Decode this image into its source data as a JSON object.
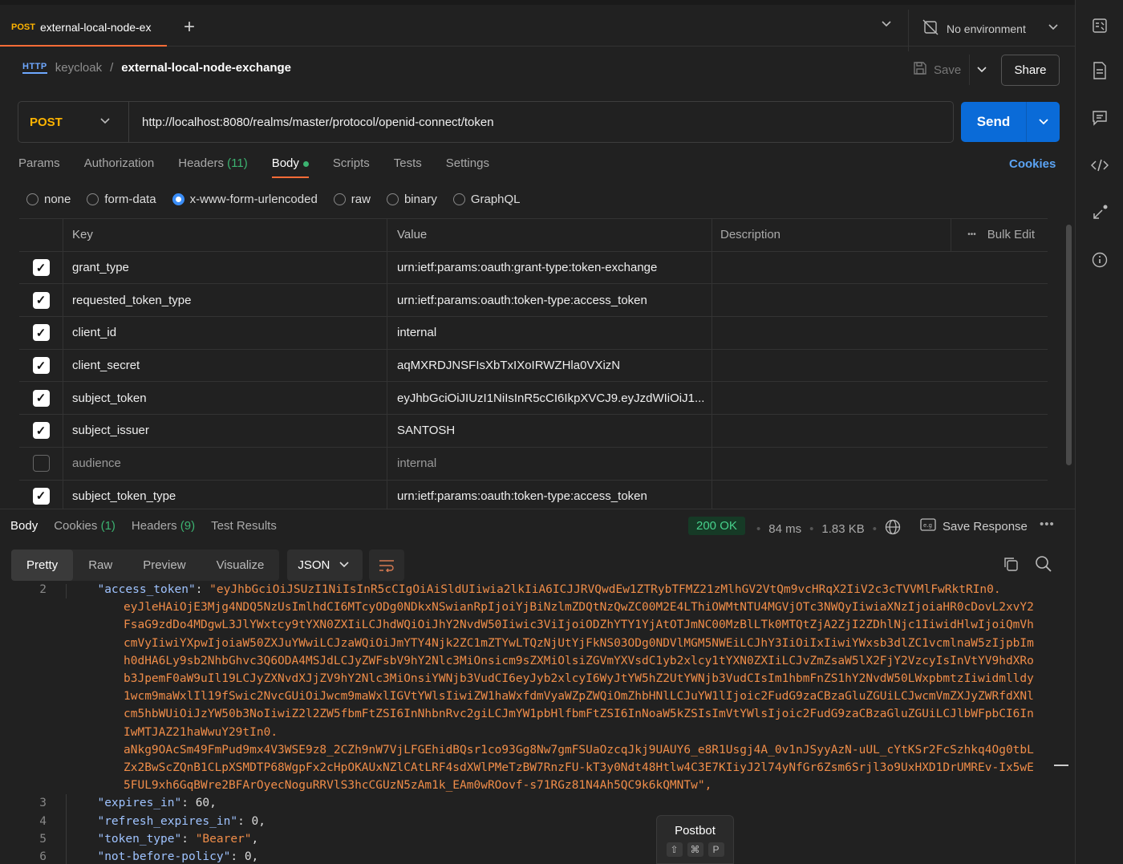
{
  "tabs": {
    "active": {
      "method": "POST",
      "title": "external-local-node-ex"
    },
    "new_tab": "+",
    "environment": "No environment"
  },
  "breadcrumb": {
    "parent": "keycloak",
    "separator": "/",
    "current": "external-local-node-exchange",
    "icon_label": "HTTP"
  },
  "actions": {
    "save": "Save",
    "share": "Share"
  },
  "request": {
    "method": "POST",
    "url": "http://localhost:8080/realms/master/protocol/openid-connect/token",
    "send": "Send"
  },
  "request_tabs": [
    {
      "label": "Params"
    },
    {
      "label": "Authorization"
    },
    {
      "label": "Headers",
      "count": "(11)"
    },
    {
      "label": "Body",
      "active": true
    },
    {
      "label": "Scripts"
    },
    {
      "label": "Tests"
    },
    {
      "label": "Settings"
    }
  ],
  "cookies_link": "Cookies",
  "body_types": [
    {
      "label": "none",
      "selected": false
    },
    {
      "label": "form-data",
      "selected": false
    },
    {
      "label": "x-www-form-urlencoded",
      "selected": true
    },
    {
      "label": "raw",
      "selected": false
    },
    {
      "label": "binary",
      "selected": false
    },
    {
      "label": "GraphQL",
      "selected": false
    }
  ],
  "table": {
    "headers": {
      "key": "Key",
      "value": "Value",
      "description": "Description",
      "bulk_edit": "Bulk Edit",
      "more": "•••"
    },
    "rows": [
      {
        "checked": true,
        "key": "grant_type",
        "value": "urn:ietf:params:oauth:grant-type:token-exchange",
        "description": ""
      },
      {
        "checked": true,
        "key": "requested_token_type",
        "value": "urn:ietf:params:oauth:token-type:access_token",
        "description": ""
      },
      {
        "checked": true,
        "key": "client_id",
        "value": "internal",
        "description": ""
      },
      {
        "checked": true,
        "key": "client_secret",
        "value": "aqMXRDJNSFIsXbTxIXoIRWZHla0VXizN",
        "description": ""
      },
      {
        "checked": true,
        "key": "subject_token",
        "value": "eyJhbGciOiJIUzI1NiIsInR5cCI6IkpXVCJ9.eyJzdWIiOiJ1...",
        "description": ""
      },
      {
        "checked": true,
        "key": "subject_issuer",
        "value": "SANTOSH",
        "description": ""
      },
      {
        "checked": false,
        "key": "audience",
        "value": "internal",
        "description": ""
      },
      {
        "checked": true,
        "key": "subject_token_type",
        "value": "urn:ietf:params:oauth:token-type:access_token",
        "description": ""
      }
    ]
  },
  "response": {
    "tabs": [
      {
        "label": "Body",
        "active": true
      },
      {
        "label": "Cookies",
        "count": "(1)"
      },
      {
        "label": "Headers",
        "count": "(9)"
      },
      {
        "label": "Test Results"
      }
    ],
    "status": "200 OK",
    "time": "84 ms",
    "size": "1.83 KB",
    "save_response": "Save Response",
    "more": "•••",
    "view_modes": [
      "Pretty",
      "Raw",
      "Preview",
      "Visualize"
    ],
    "active_view": "Pretty",
    "format": "JSON",
    "code": {
      "line2_num": "2",
      "line2_key": "\"access_token\"",
      "line2_val": "\"eyJhbGciOiJSUzI1NiIsInR5cCIgOiAiSldUIiwia2lkIiA6ICJJRVQwdEw1ZTRybTFMZ21zMlhGV2VtQm9vcHRqX2IiV2c3cTVVMlFwRktRIn0.",
      "wrapped": [
        "eyJleHAiOjE3Mjg4NDQ5NzUsImlhdCI6MTcyODg0NDkxNSwianRpIjoiYjBiNzlmZDQtNzQwZC00M2E4LThiOWMtNTU4MGVjOTc3NWQyIiwiaXNzIjoiaHR0cDovL2xvY2",
        "FsaG9zdDo4MDgwL3JlYWxtcy9tYXN0ZXIiLCJhdWQiOiJhY2NvdW50Iiwic3ViIjoiODZhYTY1YjAtOTJmNC00MzBlLTk0MTQtZjA2ZjI2ZDhlNjc1IiwidHlwIjoiQmVh",
        "cmVyIiwiYXpwIjoiaW50ZXJuYWwiLCJzaWQiOiJmYTY4Njk2ZC1mZTYwLTQzNjUtYjFkNS03ODg0NDVlMGM5NWEiLCJhY3IiOiIxIiwiYWxsb3dlZC1vcmlnaW5zIjpbIm",
        "h0dHA6Ly9sb2NhbGhvc3Q6ODA4MSJdLCJyZWFsbV9hY2Nlc3MiOnsicm9sZXMiOlsiZGVmYXVsdC1yb2xlcy1tYXN0ZXIiLCJvZmZsaW5lX2FjY2VzcyIsInVtYV9hdXRo",
        "b3JpemF0aW9uIl19LCJyZXNvdXJjZV9hY2Nlc3MiOnsiYWNjb3VudCI6eyJyb2xlcyI6WyJtYW5hZ2UtYWNjb3VudCIsIm1hbmFnZS1hY2NvdW50LWxpbmtzIiwidmlldy",
        "1wcm9maWxlIl19fSwic2NvcGUiOiJwcm9maWxlIGVtYWlsIiwiZW1haWxfdmVyaWZpZWQiOmZhbHNlLCJuYW1lIjoic2FudG9zaCBzaGluZGUiLCJwcmVmZXJyZWRfdXNl",
        "cm5hbWUiOiJzYW50b3NoIiwiZ2l2ZW5fbmFtZSI6InNhbnRvc2giLCJmYW1pbHlfbmFtZSI6InNoaW5kZSIsImVtYWlsIjoic2FudG9zaCBzaGluZGUiLCJlbWFpbCI6In",
        "IwMTJAZ21haWwuY29tIn0.",
        "aNkg9OAcSm49FmPud9mx4V3WSE9z8_2CZh9nW7VjLFGEhidBQsr1co93Gg8Nw7gmFSUaOzcqJkj9UAUY6_e8R1Usgj4A_0v1nJSyyAzN-uUL_cYtKSr2FcSzhkq4Og0tbL",
        "Zx2BwScZQnB1CLpXSMDTP68WgpFx2cHpOKAUxNZlCAtLRF4sdXWlPMeTzBW7RnzFU-kT3y0Ndt48Htlw4C3E7KIiyJ2l74yNfGr6Zsm6Srjl3o9UxHXD1DrUMREv-Ix5wE",
        "5FUL9xh6GqBWre2BFArOyecNoguRRVlS3hcCGUzN5zAm1k_EAm0wROovf-s71RGz81N4Ah5QC9k6kQMNTw\","
      ],
      "lines": [
        {
          "num": "3",
          "key": "\"expires_in\"",
          "val": "60",
          "type": "num"
        },
        {
          "num": "4",
          "key": "\"refresh_expires_in\"",
          "val": "0",
          "type": "num"
        },
        {
          "num": "5",
          "key": "\"token_type\"",
          "val": "\"Bearer\"",
          "type": "str"
        },
        {
          "num": "6",
          "key": "\"not-before-policy\"",
          "val": "0",
          "type": "num"
        }
      ]
    }
  },
  "postbot": {
    "title": "Postbot",
    "keys": [
      "⇧",
      "⌘",
      "P"
    ]
  },
  "colors": {
    "accent": "#ff6c37",
    "send": "#0a6bd8",
    "method": "#ffb400",
    "status_ok": "#47d18c",
    "json_string": "#f08d49",
    "json_key": "#9fc3ff"
  }
}
